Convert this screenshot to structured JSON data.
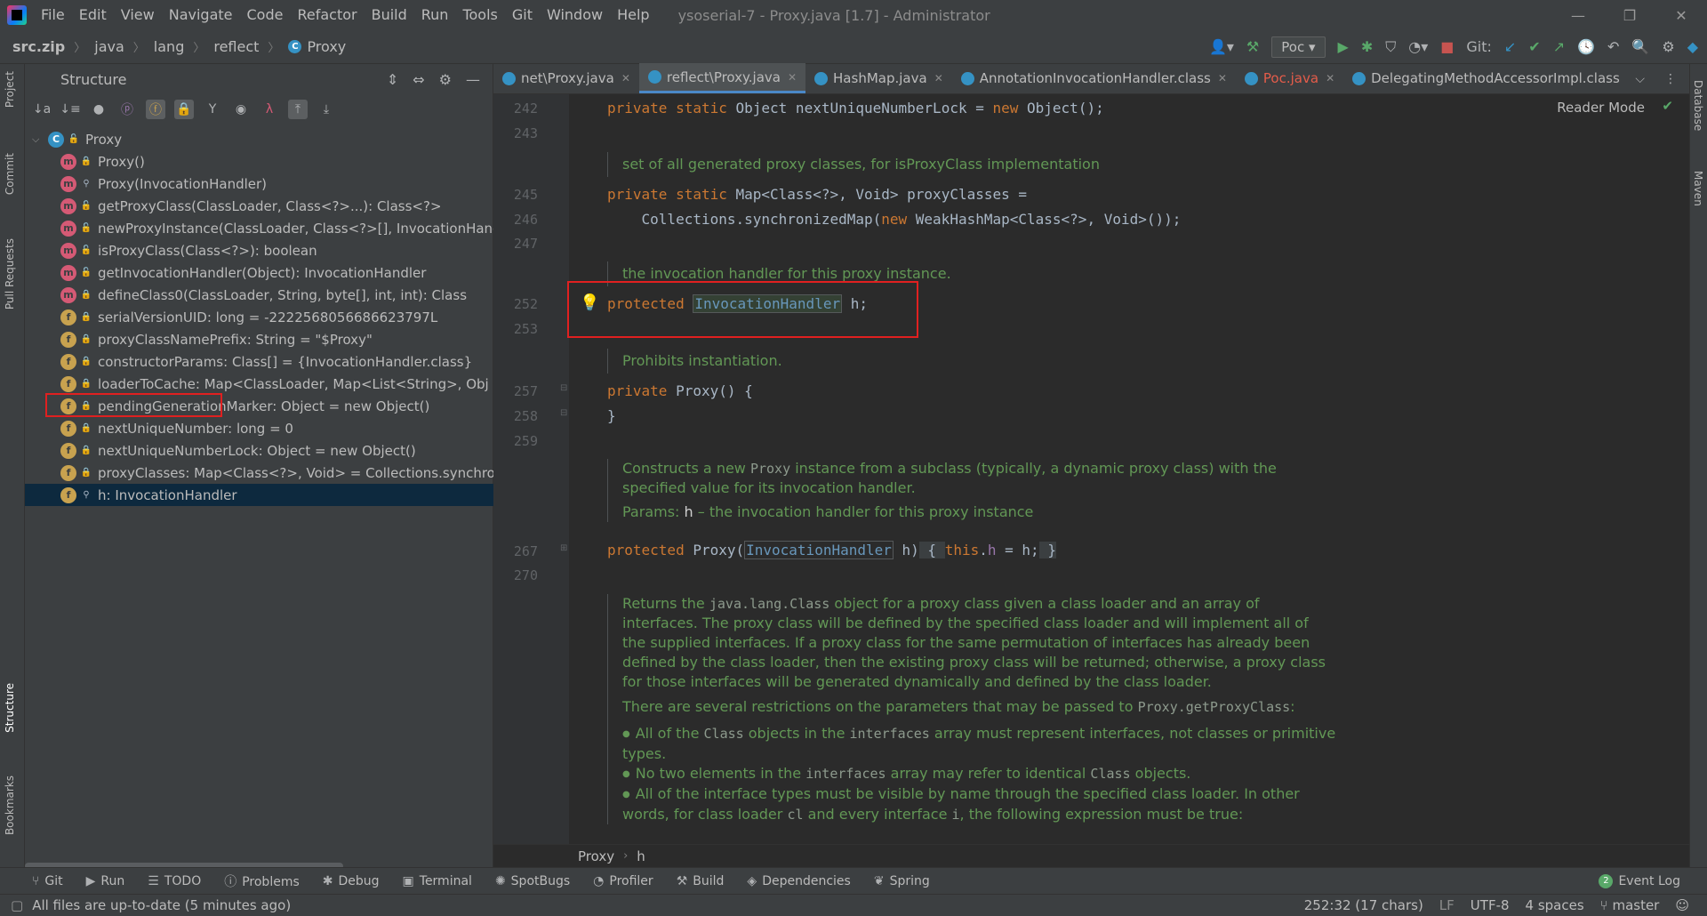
{
  "window": {
    "title": "ysoserial-7 - Proxy.java [1.7] - Administrator"
  },
  "menu": [
    "File",
    "Edit",
    "View",
    "Navigate",
    "Code",
    "Refactor",
    "Build",
    "Run",
    "Tools",
    "Git",
    "Window",
    "Help"
  ],
  "breadcrumbs": [
    "src.zip",
    "java",
    "lang",
    "reflect",
    "Proxy"
  ],
  "toolbar": {
    "run_config": "Poc",
    "git_label": "Git:"
  },
  "side_tabs_left": [
    "Project",
    "Commit",
    "Pull Requests",
    "Structure",
    "Bookmarks"
  ],
  "side_tabs_right": [
    "Database",
    "Maven"
  ],
  "structure": {
    "title": "Structure",
    "root": "Proxy",
    "items": [
      {
        "kind": "m",
        "vis": "priv",
        "label": "Proxy()"
      },
      {
        "kind": "m",
        "vis": "pkg",
        "label": "Proxy(InvocationHandler)"
      },
      {
        "kind": "m",
        "vis": "pub",
        "label": "getProxyClass(ClassLoader, Class<?>...): Class<?>"
      },
      {
        "kind": "m",
        "vis": "pub",
        "label": "newProxyInstance(ClassLoader, Class<?>[], InvocationHand"
      },
      {
        "kind": "m",
        "vis": "pub",
        "label": "isProxyClass(Class<?>): boolean"
      },
      {
        "kind": "m",
        "vis": "pub",
        "label": "getInvocationHandler(Object): InvocationHandler"
      },
      {
        "kind": "m",
        "vis": "priv",
        "label": "defineClass0(ClassLoader, String, byte[], int, int): Class"
      },
      {
        "kind": "f",
        "vis": "priv",
        "label": "serialVersionUID: long = -2222568056686623797L"
      },
      {
        "kind": "f",
        "vis": "priv",
        "label": "proxyClassNamePrefix: String = \"$Proxy\""
      },
      {
        "kind": "f",
        "vis": "priv",
        "label": "constructorParams: Class[] = {InvocationHandler.class}"
      },
      {
        "kind": "f",
        "vis": "priv",
        "label": "loaderToCache: Map<ClassLoader, Map<List<String>, Obj"
      },
      {
        "kind": "f",
        "vis": "priv",
        "label": "pendingGenerationMarker: Object = new Object()"
      },
      {
        "kind": "f",
        "vis": "priv",
        "label": "nextUniqueNumber: long = 0"
      },
      {
        "kind": "f",
        "vis": "priv",
        "label": "nextUniqueNumberLock: Object = new Object()"
      },
      {
        "kind": "f",
        "vis": "priv",
        "label": "proxyClasses: Map<Class<?>, Void> = Collections.synchror"
      },
      {
        "kind": "f",
        "vis": "pkg",
        "label": "h: InvocationHandler",
        "selected": true
      }
    ]
  },
  "tabs": [
    {
      "label": "net\\Proxy.java"
    },
    {
      "label": "reflect\\Proxy.java",
      "active": true
    },
    {
      "label": "HashMap.java"
    },
    {
      "label": "AnnotationInvocationHandler.class"
    },
    {
      "label": "Poc.java",
      "red": true
    },
    {
      "label": "DelegatingMethodAccessorImpl.class"
    }
  ],
  "editor": {
    "reader_mode": "Reader Mode",
    "lines": {
      "l242": "242",
      "l243": "243",
      "l245": "245",
      "l246": "246",
      "l247": "247",
      "l252": "252",
      "l253": "253",
      "l257": "257",
      "l258": "258",
      "l259": "259",
      "l267": "267",
      "l270": "270"
    },
    "doc1": "set of all generated proxy classes, for isProxyClass implementation",
    "doc2": "the invocation handler for this proxy instance.",
    "doc3": "Prohibits instantiation.",
    "doc4a": "Constructs a new ",
    "doc4code": "Proxy",
    "doc4b": " instance from a subclass (typically, a dynamic proxy class) with the specified value for its invocation handler.",
    "doc4params": "Params: ",
    "doc4pname": "h",
    "doc4pdesc": " – the invocation handler for this proxy instance",
    "doc5a": "Returns the ",
    "doc5code": "java.lang.Class",
    "doc5b": " object for a proxy class given a class loader and an array of interfaces. The proxy class will be defined by the specified class loader and will implement all of the supplied interfaces. If a proxy class for the same permutation of interfaces has already been defined by the class loader, then the existing proxy class will be returned; otherwise, a proxy class for those interfaces will be generated dynamically and defined by the class loader.",
    "doc6a": "There are several restrictions on the parameters that may be passed to ",
    "doc6code": "Proxy.getProxyClass",
    "doc6b": ":",
    "bul1a": "All of the ",
    "bul1c": "Class",
    "bul1b": " objects in the ",
    "bul1d": "interfaces",
    "bul1e": " array must represent interfaces, not classes or primitive types.",
    "bul2a": "No two elements in the ",
    "bul2c": "interfaces",
    "bul2b": " array may refer to identical ",
    "bul2d": "Class",
    "bul2e": " objects.",
    "bul3a": "All of the interface types must be visible by name through the specified class loader. In other words, for class loader ",
    "bul3c": "cl",
    "bul3b": " and every interface ",
    "bul3d": "i",
    "bul3e": ", the following expression must be true:"
  },
  "code_breadcrumb": [
    "Proxy",
    "h"
  ],
  "bottom_tools": [
    "Git",
    "Run",
    "TODO",
    "Problems",
    "Debug",
    "Terminal",
    "SpotBugs",
    "Profiler",
    "Build",
    "Dependencies",
    "Spring"
  ],
  "event_log": {
    "count": "2",
    "label": "Event Log"
  },
  "status": {
    "message": "All files are up-to-date (5 minutes ago)",
    "position": "252:32 (17 chars)",
    "line_sep": "LF",
    "encoding": "UTF-8",
    "indent": "4 spaces",
    "branch": "master"
  }
}
